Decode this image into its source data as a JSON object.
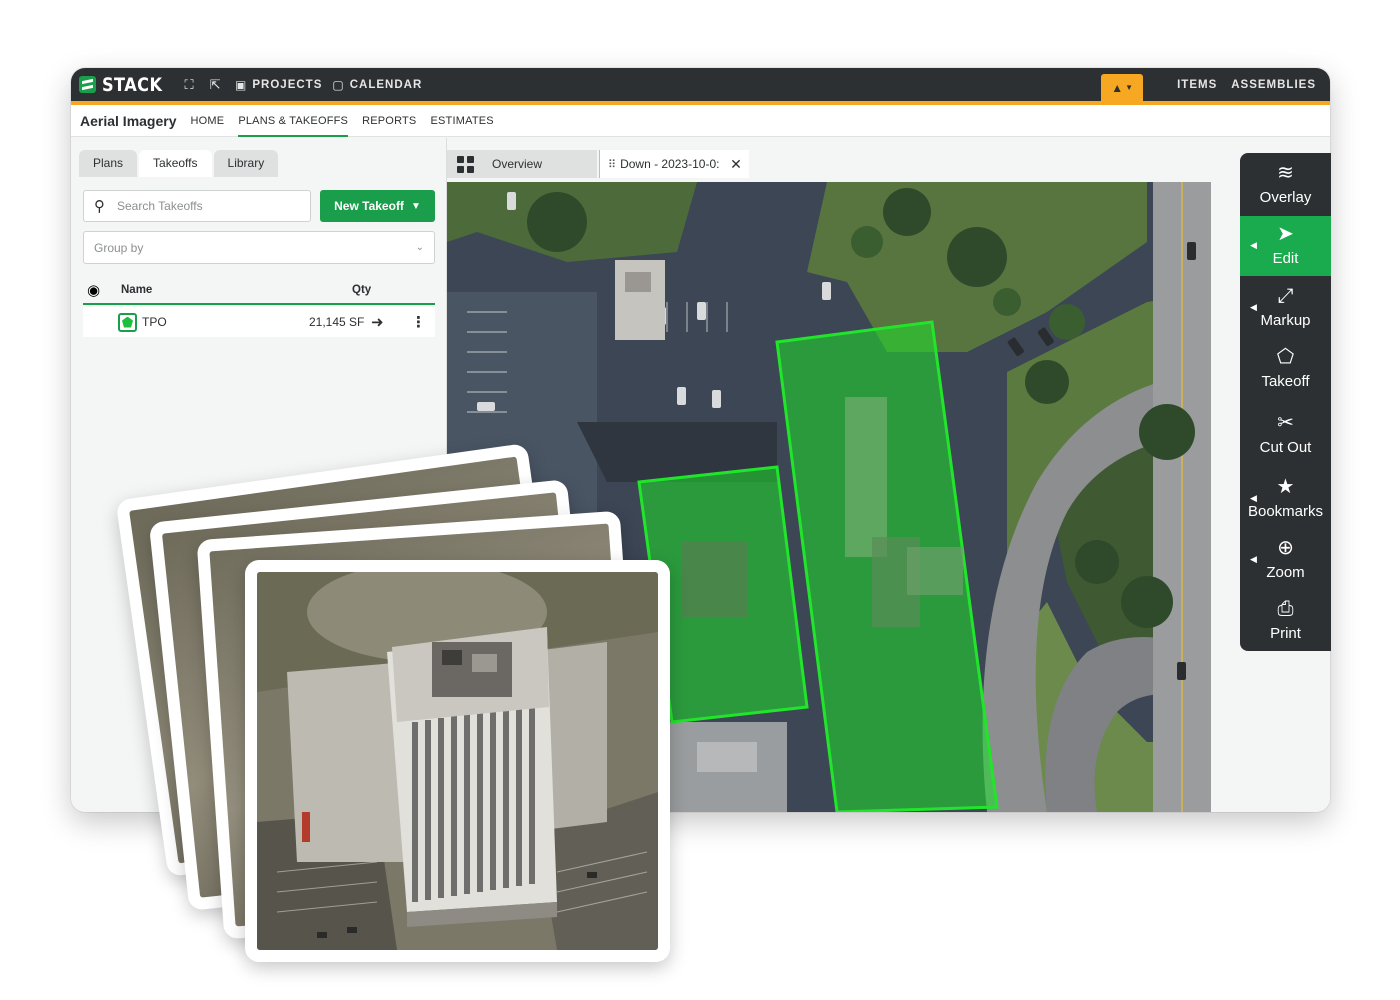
{
  "topbar": {
    "logo_text": "STACK",
    "nav": [
      {
        "label": "PROJECTS",
        "icon": "briefcase-icon"
      },
      {
        "label": "CALENDAR",
        "icon": "calendar-icon"
      }
    ],
    "right_nav": [
      "ITEMS",
      "ASSEMBLIES"
    ],
    "accent_color": "#f7a823",
    "brand_color": "#1b9e4b"
  },
  "subnav": {
    "project_title": "Aerial Imagery",
    "links": [
      "HOME",
      "PLANS & TAKEOFFS",
      "REPORTS",
      "ESTIMATES"
    ],
    "active_link": "PLANS & TAKEOFFS"
  },
  "left_panel": {
    "tabs": [
      "Plans",
      "Takeoffs",
      "Library"
    ],
    "active_tab": "Takeoffs",
    "search_placeholder": "Search Takeoffs",
    "new_button_label": "New Takeoff",
    "group_by_placeholder": "Group by",
    "columns": {
      "name": "Name",
      "qty": "Qty"
    },
    "rows": [
      {
        "name": "TPO",
        "qty": "21,145 SF",
        "color": "#1bbf3a"
      }
    ]
  },
  "viewer": {
    "tabs": [
      {
        "label": "Overview",
        "icon": "grid-icon"
      },
      {
        "label": "Down - 2023-10-0:",
        "icon": "drag-handle-icon",
        "closable": true
      }
    ]
  },
  "toolbox": {
    "tools": [
      {
        "label": "Overlay",
        "icon": "layers-plus-icon",
        "active": false,
        "submenu": false
      },
      {
        "label": "Edit",
        "icon": "cursor-arrow-icon",
        "active": true,
        "submenu": true
      },
      {
        "label": "Markup",
        "icon": "expand-arrows-icon",
        "active": false,
        "submenu": true
      },
      {
        "label": "Takeoff",
        "icon": "polygon-icon",
        "active": false,
        "submenu": false
      },
      {
        "label": "Cut Out",
        "icon": "cut-out-icon",
        "active": false,
        "submenu": false
      },
      {
        "label": "Bookmarks",
        "icon": "star-icon",
        "active": false,
        "submenu": true
      },
      {
        "label": "Zoom",
        "icon": "zoom-in-icon",
        "active": false,
        "submenu": true
      },
      {
        "label": "Print",
        "icon": "printer-icon",
        "active": false,
        "submenu": false
      }
    ]
  }
}
